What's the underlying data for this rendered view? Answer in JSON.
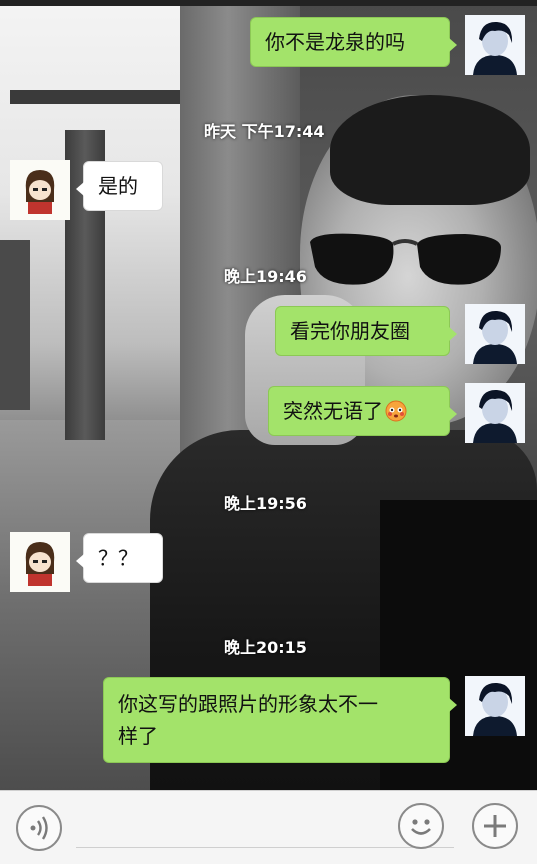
{
  "messages": [
    {
      "side": "right",
      "text": "你不是龙泉的吗"
    },
    {
      "type": "timestamp",
      "text": "昨天 下午17:44"
    },
    {
      "side": "left",
      "text": "是的"
    },
    {
      "type": "timestamp",
      "text": "晚上19:46"
    },
    {
      "side": "right",
      "text": "看完你朋友圈"
    },
    {
      "side": "right",
      "text": "突然无语了",
      "emoji": "flushed-face-emoji"
    },
    {
      "type": "timestamp",
      "text": "晚上19:56"
    },
    {
      "side": "left",
      "text": "？？"
    },
    {
      "type": "timestamp",
      "text": "晚上20:15"
    },
    {
      "side": "right",
      "text_line1": "你这写的跟照片的形象太不一",
      "text_line2": "样了"
    }
  ],
  "input_bar": {
    "voice_icon": "voice-wave-icon",
    "emoji_icon": "smiley-icon",
    "plus_icon": "plus-icon",
    "text_value": ""
  },
  "colors": {
    "outgoing_bubble": "#a3e36a",
    "incoming_bubble": "#ffffff",
    "timestamp_text": "#ffffff"
  }
}
